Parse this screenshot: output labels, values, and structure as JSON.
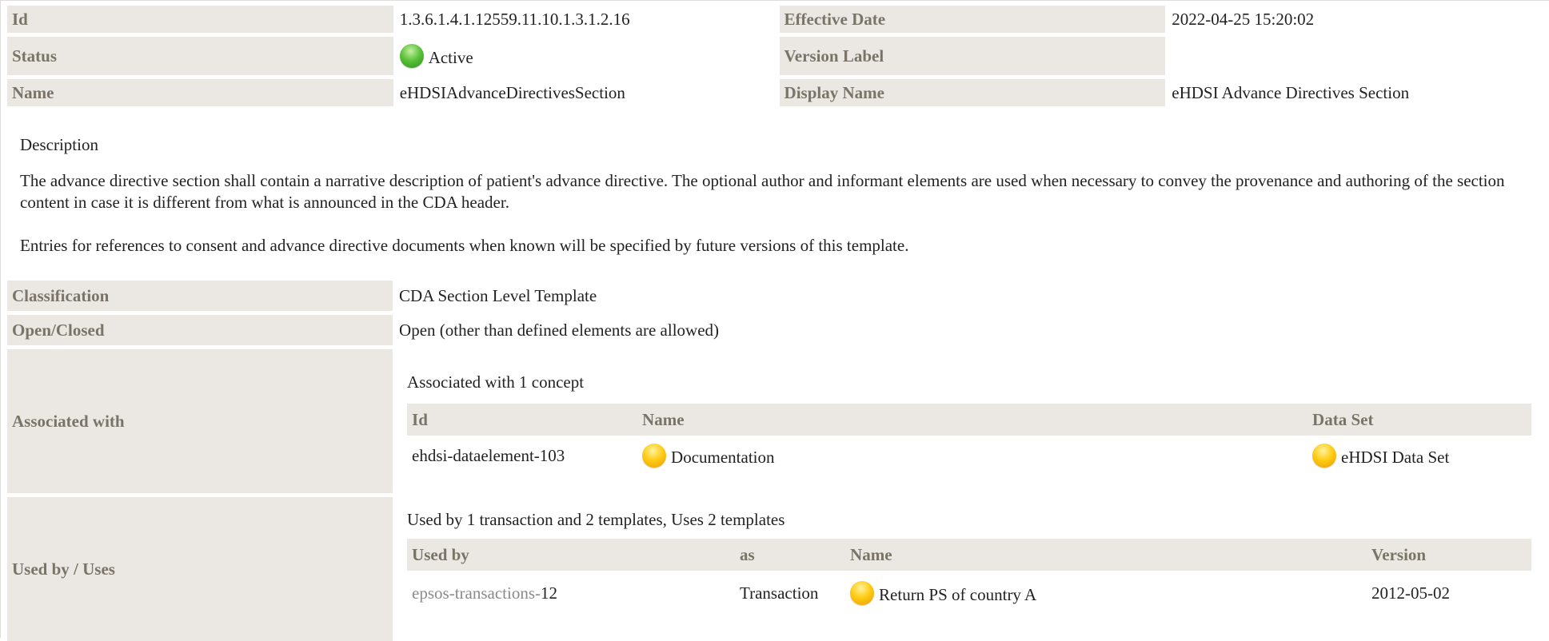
{
  "header": {
    "id_label": "Id",
    "id_value": "1.3.6.1.4.1.12559.11.10.1.3.1.2.16",
    "effective_date_label": "Effective Date",
    "effective_date_value": "2022-04-25 15:20:02",
    "status_label": "Status",
    "status_value": "Active",
    "version_label_label": "Version Label",
    "version_label_value": "",
    "name_label": "Name",
    "name_value": "eHDSIAdvanceDirectivesSection",
    "display_name_label": "Display Name",
    "display_name_value": "eHDSI Advance Directives Section"
  },
  "description": {
    "heading": "Description",
    "paragraph_1": "The advance directive section shall contain a narrative description of patient's advance directive. The optional author and informant elements are used when necessary to convey the provenance and authoring of the section content in case it is different from what is announced in the CDA header.",
    "paragraph_2": "Entries for references to consent and advance directive documents when known will be specified by future versions of this template."
  },
  "properties": {
    "classification_label": "Classification",
    "classification_value": "CDA Section Level Template",
    "open_closed_label": "Open/Closed",
    "open_closed_value": "Open (other than defined elements are allowed)"
  },
  "associated": {
    "label": "Associated with",
    "summary": "Associated with 1 concept",
    "columns": [
      "Id",
      "Name",
      "Data Set"
    ],
    "rows": [
      {
        "id": "ehdsi-dataelement-103",
        "name": "Documentation",
        "dataset": "eHDSI Data Set"
      }
    ]
  },
  "used_by": {
    "label": "Used by / Uses",
    "summary": "Used by 1 transaction and 2 templates, Uses 2 templates",
    "columns": [
      "Used by",
      "as",
      "Name",
      "Version"
    ],
    "rows": [
      {
        "used_by_prefix": "epsos-transactions-",
        "used_by_suffix": "12",
        "as": "Transaction",
        "name": "Return PS of country A",
        "version": "2012-05-02"
      }
    ]
  },
  "colors": {
    "label_bg": "#ebe8e4",
    "label_text": "#7a7468",
    "status_active": "#5bc23a",
    "status_draft": "#ffcc14"
  },
  "icons": {
    "status": "green-status-orb-icon",
    "concept": "yellow-status-orb-icon"
  }
}
